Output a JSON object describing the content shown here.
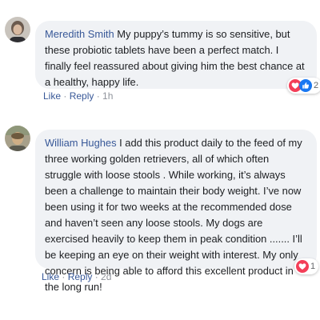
{
  "comments": [
    {
      "author": "Meredith Smith",
      "text": "My puppy’s tummy is so sensitive, but these probiotic tablets have been a perfect match. I finally feel reassured about giving him the best chance at a healthy, happy life.",
      "reaction_count": "2",
      "like_label": "Like",
      "reply_label": "Reply",
      "time": "1h"
    },
    {
      "author": "William Hughes",
      "text": "I add this product daily to the feed of my three working golden retrievers, all of which often struggle with loose stools . While working, it’s always been a challenge to maintain their body weight. I’ve now been using it for two weeks at the recommended dose and haven’t seen any loose stools. My dogs are exercised heavily to keep them in peak condition ....... I’ll be keeping an eye on their weight with interest. My only concern is being able to afford this excellent product in the long run!",
      "reaction_count": "1",
      "like_label": "Like",
      "reply_label": "Reply",
      "time": "2d"
    }
  ],
  "colors": {
    "author": "#385898",
    "bubble": "#f0f2f5",
    "love": "#f33e58",
    "like": "#1877f2"
  },
  "icons": [
    "heart-icon",
    "thumbs-up-icon"
  ]
}
